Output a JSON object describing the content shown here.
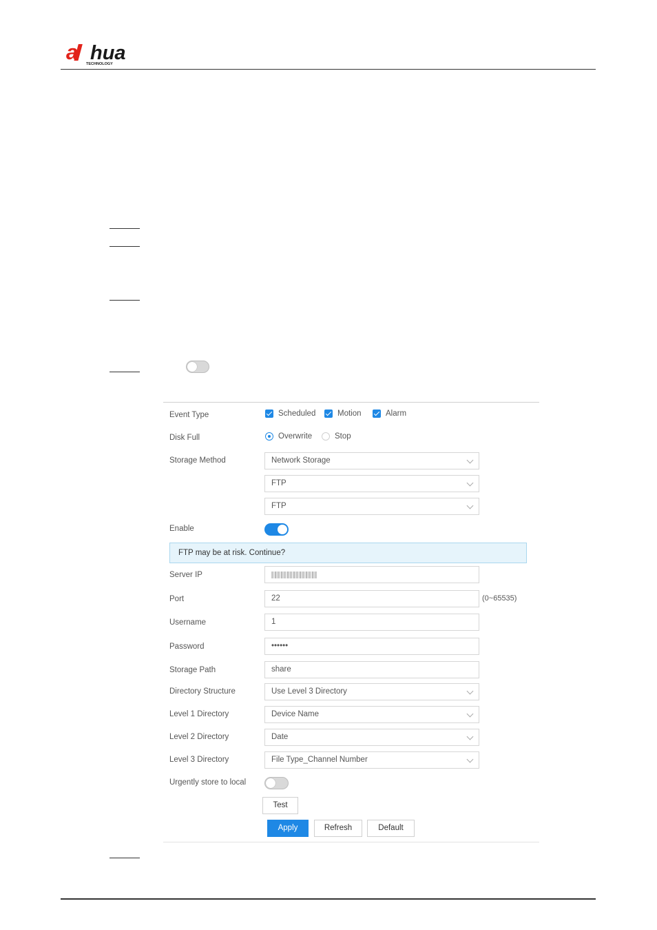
{
  "brand": {
    "logo_text": "alhua",
    "logo_subtext": "TECHNOLOGY",
    "accent": "#e2231a"
  },
  "intro_toggle": {
    "state": "off"
  },
  "form": {
    "event_type": {
      "label": "Event Type",
      "options": [
        "Scheduled",
        "Motion",
        "Alarm"
      ]
    },
    "disk_full": {
      "label": "Disk Full",
      "options": [
        "Overwrite",
        "Stop"
      ],
      "selected": "Overwrite"
    },
    "storage_method": {
      "label": "Storage Method",
      "value": "Network Storage",
      "protocol": "FTP",
      "protocol_mode": "FTP"
    },
    "enable": {
      "label": "Enable",
      "state": "on"
    },
    "alert": "FTP may be at risk. Continue?",
    "server_ip": {
      "label": "Server IP"
    },
    "port": {
      "label": "Port",
      "value": "22",
      "range": "(0~65535)"
    },
    "username": {
      "label": "Username",
      "value": "1"
    },
    "password": {
      "label": "Password",
      "value": "••••••"
    },
    "storage_path": {
      "label": "Storage Path",
      "value": "share"
    },
    "directory_structure": {
      "label": "Directory Structure",
      "value": "Use Level 3 Directory"
    },
    "level1": {
      "label": "Level 1 Directory",
      "value": "Device Name"
    },
    "level2": {
      "label": "Level 2 Directory",
      "value": "Date"
    },
    "level3": {
      "label": "Level 3 Directory",
      "value": "File Type_Channel Number"
    },
    "urgent_local": {
      "label": "Urgently store to local",
      "state": "off"
    },
    "buttons": {
      "test": "Test",
      "apply": "Apply",
      "refresh": "Refresh",
      "default": "Default"
    }
  }
}
